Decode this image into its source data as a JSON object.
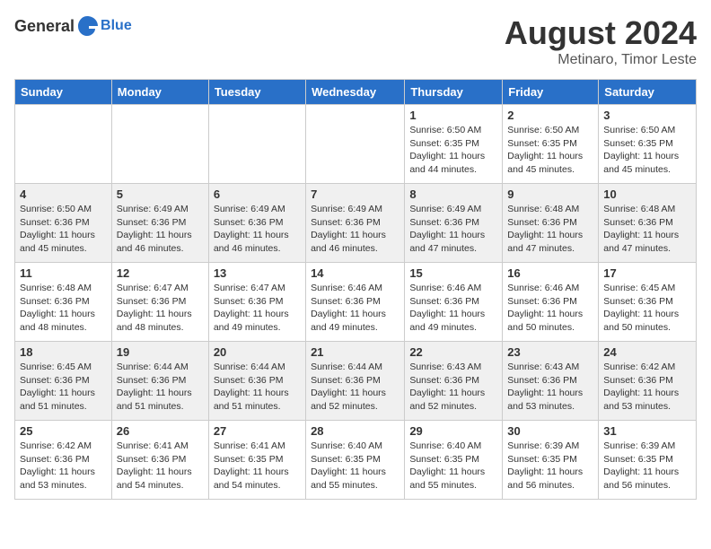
{
  "header": {
    "logo_general": "General",
    "logo_blue": "Blue",
    "month_year": "August 2024",
    "location": "Metinaro, Timor Leste"
  },
  "weekdays": [
    "Sunday",
    "Monday",
    "Tuesday",
    "Wednesday",
    "Thursday",
    "Friday",
    "Saturday"
  ],
  "weeks": [
    [
      {
        "day": "",
        "sunrise": "",
        "sunset": "",
        "daylight": ""
      },
      {
        "day": "",
        "sunrise": "",
        "sunset": "",
        "daylight": ""
      },
      {
        "day": "",
        "sunrise": "",
        "sunset": "",
        "daylight": ""
      },
      {
        "day": "",
        "sunrise": "",
        "sunset": "",
        "daylight": ""
      },
      {
        "day": "1",
        "sunrise": "Sunrise: 6:50 AM",
        "sunset": "Sunset: 6:35 PM",
        "daylight": "Daylight: 11 hours and 44 minutes."
      },
      {
        "day": "2",
        "sunrise": "Sunrise: 6:50 AM",
        "sunset": "Sunset: 6:35 PM",
        "daylight": "Daylight: 11 hours and 45 minutes."
      },
      {
        "day": "3",
        "sunrise": "Sunrise: 6:50 AM",
        "sunset": "Sunset: 6:35 PM",
        "daylight": "Daylight: 11 hours and 45 minutes."
      }
    ],
    [
      {
        "day": "4",
        "sunrise": "Sunrise: 6:50 AM",
        "sunset": "Sunset: 6:36 PM",
        "daylight": "Daylight: 11 hours and 45 minutes."
      },
      {
        "day": "5",
        "sunrise": "Sunrise: 6:49 AM",
        "sunset": "Sunset: 6:36 PM",
        "daylight": "Daylight: 11 hours and 46 minutes."
      },
      {
        "day": "6",
        "sunrise": "Sunrise: 6:49 AM",
        "sunset": "Sunset: 6:36 PM",
        "daylight": "Daylight: 11 hours and 46 minutes."
      },
      {
        "day": "7",
        "sunrise": "Sunrise: 6:49 AM",
        "sunset": "Sunset: 6:36 PM",
        "daylight": "Daylight: 11 hours and 46 minutes."
      },
      {
        "day": "8",
        "sunrise": "Sunrise: 6:49 AM",
        "sunset": "Sunset: 6:36 PM",
        "daylight": "Daylight: 11 hours and 47 minutes."
      },
      {
        "day": "9",
        "sunrise": "Sunrise: 6:48 AM",
        "sunset": "Sunset: 6:36 PM",
        "daylight": "Daylight: 11 hours and 47 minutes."
      },
      {
        "day": "10",
        "sunrise": "Sunrise: 6:48 AM",
        "sunset": "Sunset: 6:36 PM",
        "daylight": "Daylight: 11 hours and 47 minutes."
      }
    ],
    [
      {
        "day": "11",
        "sunrise": "Sunrise: 6:48 AM",
        "sunset": "Sunset: 6:36 PM",
        "daylight": "Daylight: 11 hours and 48 minutes."
      },
      {
        "day": "12",
        "sunrise": "Sunrise: 6:47 AM",
        "sunset": "Sunset: 6:36 PM",
        "daylight": "Daylight: 11 hours and 48 minutes."
      },
      {
        "day": "13",
        "sunrise": "Sunrise: 6:47 AM",
        "sunset": "Sunset: 6:36 PM",
        "daylight": "Daylight: 11 hours and 49 minutes."
      },
      {
        "day": "14",
        "sunrise": "Sunrise: 6:46 AM",
        "sunset": "Sunset: 6:36 PM",
        "daylight": "Daylight: 11 hours and 49 minutes."
      },
      {
        "day": "15",
        "sunrise": "Sunrise: 6:46 AM",
        "sunset": "Sunset: 6:36 PM",
        "daylight": "Daylight: 11 hours and 49 minutes."
      },
      {
        "day": "16",
        "sunrise": "Sunrise: 6:46 AM",
        "sunset": "Sunset: 6:36 PM",
        "daylight": "Daylight: 11 hours and 50 minutes."
      },
      {
        "day": "17",
        "sunrise": "Sunrise: 6:45 AM",
        "sunset": "Sunset: 6:36 PM",
        "daylight": "Daylight: 11 hours and 50 minutes."
      }
    ],
    [
      {
        "day": "18",
        "sunrise": "Sunrise: 6:45 AM",
        "sunset": "Sunset: 6:36 PM",
        "daylight": "Daylight: 11 hours and 51 minutes."
      },
      {
        "day": "19",
        "sunrise": "Sunrise: 6:44 AM",
        "sunset": "Sunset: 6:36 PM",
        "daylight": "Daylight: 11 hours and 51 minutes."
      },
      {
        "day": "20",
        "sunrise": "Sunrise: 6:44 AM",
        "sunset": "Sunset: 6:36 PM",
        "daylight": "Daylight: 11 hours and 51 minutes."
      },
      {
        "day": "21",
        "sunrise": "Sunrise: 6:44 AM",
        "sunset": "Sunset: 6:36 PM",
        "daylight": "Daylight: 11 hours and 52 minutes."
      },
      {
        "day": "22",
        "sunrise": "Sunrise: 6:43 AM",
        "sunset": "Sunset: 6:36 PM",
        "daylight": "Daylight: 11 hours and 52 minutes."
      },
      {
        "day": "23",
        "sunrise": "Sunrise: 6:43 AM",
        "sunset": "Sunset: 6:36 PM",
        "daylight": "Daylight: 11 hours and 53 minutes."
      },
      {
        "day": "24",
        "sunrise": "Sunrise: 6:42 AM",
        "sunset": "Sunset: 6:36 PM",
        "daylight": "Daylight: 11 hours and 53 minutes."
      }
    ],
    [
      {
        "day": "25",
        "sunrise": "Sunrise: 6:42 AM",
        "sunset": "Sunset: 6:36 PM",
        "daylight": "Daylight: 11 hours and 53 minutes."
      },
      {
        "day": "26",
        "sunrise": "Sunrise: 6:41 AM",
        "sunset": "Sunset: 6:36 PM",
        "daylight": "Daylight: 11 hours and 54 minutes."
      },
      {
        "day": "27",
        "sunrise": "Sunrise: 6:41 AM",
        "sunset": "Sunset: 6:35 PM",
        "daylight": "Daylight: 11 hours and 54 minutes."
      },
      {
        "day": "28",
        "sunrise": "Sunrise: 6:40 AM",
        "sunset": "Sunset: 6:35 PM",
        "daylight": "Daylight: 11 hours and 55 minutes."
      },
      {
        "day": "29",
        "sunrise": "Sunrise: 6:40 AM",
        "sunset": "Sunset: 6:35 PM",
        "daylight": "Daylight: 11 hours and 55 minutes."
      },
      {
        "day": "30",
        "sunrise": "Sunrise: 6:39 AM",
        "sunset": "Sunset: 6:35 PM",
        "daylight": "Daylight: 11 hours and 56 minutes."
      },
      {
        "day": "31",
        "sunrise": "Sunrise: 6:39 AM",
        "sunset": "Sunset: 6:35 PM",
        "daylight": "Daylight: 11 hours and 56 minutes."
      }
    ]
  ]
}
